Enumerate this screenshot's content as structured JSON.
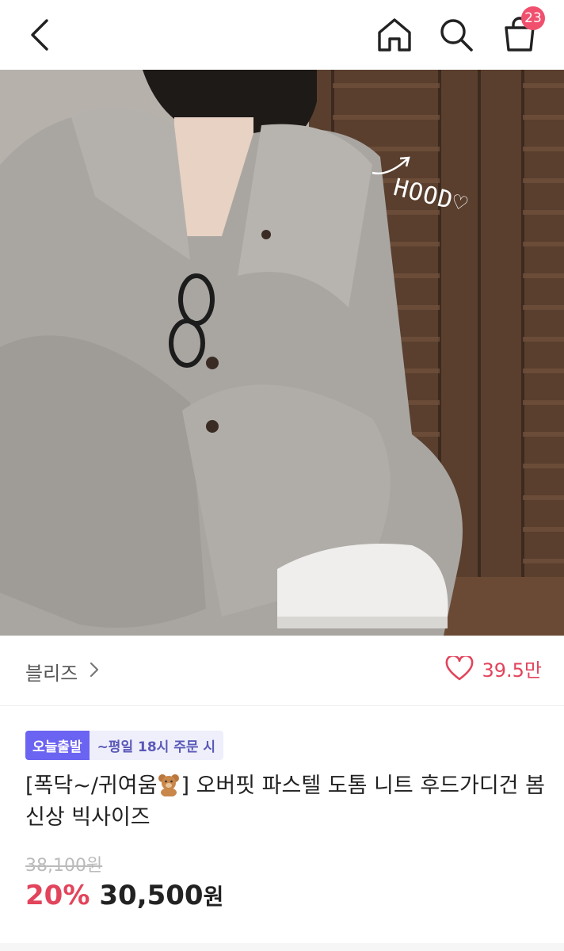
{
  "topbar": {
    "back_icon": "chevron-left-icon",
    "home_icon": "home-icon",
    "search_icon": "search-icon",
    "cart_icon": "shopping-bag-icon",
    "cart_count": "23"
  },
  "gallery": {
    "overlay_text": "HOOD♡",
    "image_count": 2,
    "active_index": 0,
    "expand_icon": "expand-icon"
  },
  "store": {
    "name": "블리즈",
    "like_count": "39.5만"
  },
  "product": {
    "tag_today": "오늘출발",
    "tag_cutoff": "~평일 18시 주문 시",
    "title_pre": "[폭닥~/귀여움",
    "title_post": "] 오버핏 파스텔 도톰 니트 후드가디건 봄신상 빅사이즈",
    "original_price": "38,100원",
    "discount": "20%",
    "price": "30,500",
    "currency": "원"
  },
  "colors": {
    "accent": "#e2445c",
    "badge": "#f0506e",
    "tag": "#6b63f1"
  }
}
